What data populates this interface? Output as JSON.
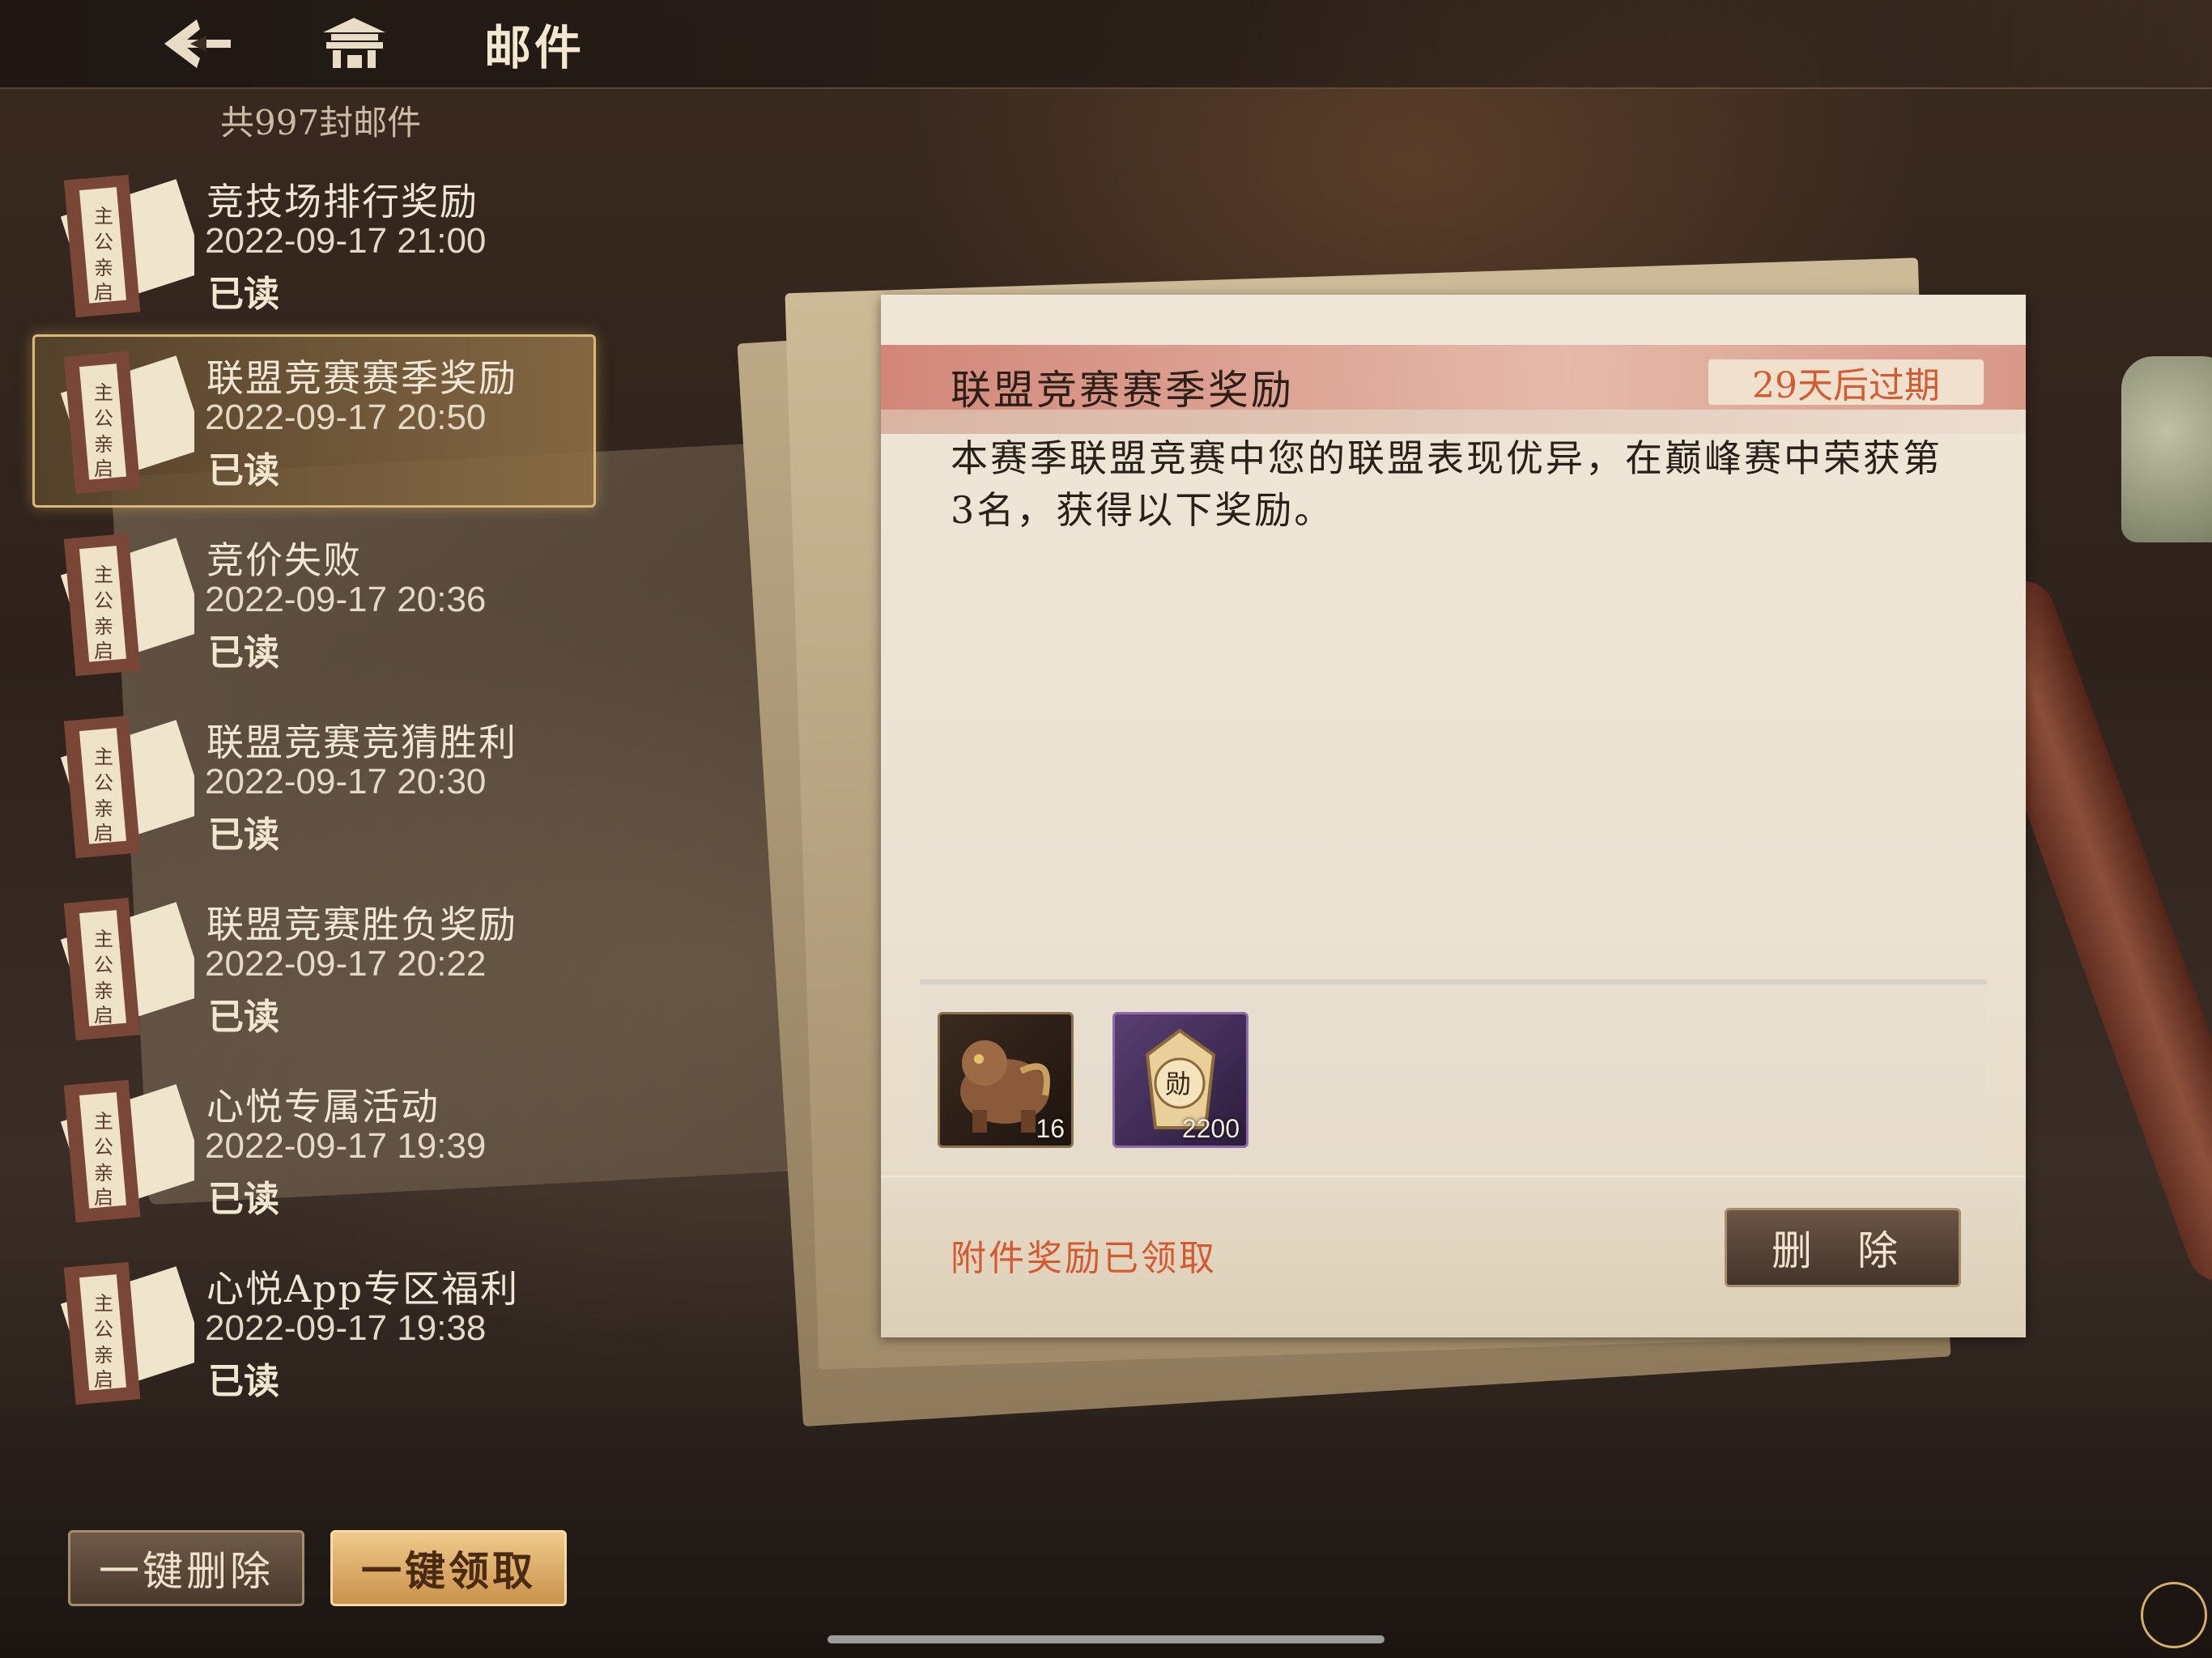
{
  "header": {
    "title": "邮件",
    "back_icon": "back-arrow-icon",
    "home_icon": "palace-home-icon"
  },
  "mail_count": "共997封邮件",
  "mails": [
    {
      "subject": "竞技场排行奖励",
      "date": "2022-09-17 21:00",
      "status": "已读",
      "icon": "scroll-letter-icon"
    },
    {
      "subject": "联盟竞赛赛季奖励",
      "date": "2022-09-17 20:50",
      "status": "已读",
      "icon": "scroll-letter-icon",
      "selected": true
    },
    {
      "subject": "竞价失败",
      "date": "2022-09-17 20:36",
      "status": "已读",
      "icon": "scroll-letter-icon"
    },
    {
      "subject": "联盟竞赛竞猜胜利",
      "date": "2022-09-17 20:30",
      "status": "已读",
      "icon": "scroll-letter-icon"
    },
    {
      "subject": "联盟竞赛胜负奖励",
      "date": "2022-09-17 20:22",
      "status": "已读",
      "icon": "scroll-letter-icon"
    },
    {
      "subject": "心悦专属活动",
      "date": "2022-09-17 19:39",
      "status": "已读",
      "icon": "scroll-letter-icon"
    },
    {
      "subject": "心悦App专区福利",
      "date": "2022-09-17 19:38",
      "status": "已读",
      "icon": "scroll-letter-icon"
    }
  ],
  "buttons": {
    "delete_all": "一键删除",
    "claim_all": "一键领取"
  },
  "letter": {
    "title": "联盟竞赛赛季奖励",
    "expiry": "29天后过期",
    "body": "本赛季联盟竞赛中您的联盟表现优异，在巅峰赛中荣获第3名，获得以下奖励。",
    "attachments": [
      {
        "icon": "beast-statue-icon",
        "quantity": "16"
      },
      {
        "icon": "merit-token-icon",
        "quantity": "2200"
      }
    ],
    "claimed_text": "附件奖励已领取",
    "delete_label": "删 除"
  },
  "colors": {
    "accent_red": "#d45a32",
    "gold": "#d9b878"
  }
}
